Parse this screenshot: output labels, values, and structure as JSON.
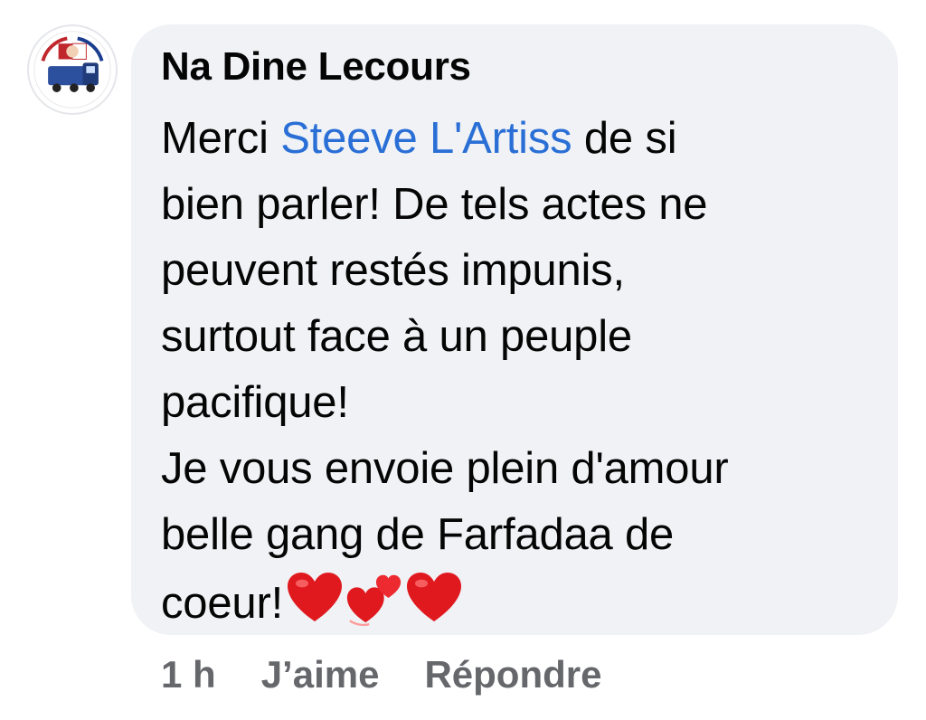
{
  "comment": {
    "author": "Na Dine Lecours",
    "message_lines": [
      {
        "before": "Merci ",
        "mention": "Steeve L'Artiss",
        "after": " de si"
      },
      "bien parler! De tels actes ne",
      "peuvent restés impunis,",
      "surtout face à un peuple",
      "pacifique!",
      "Je vous envoie plein d'amour",
      "belle gang de Farfadaa de",
      "coeur!"
    ],
    "emojis": [
      "red-heart",
      "two-hearts",
      "red-heart"
    ],
    "time": "1 h",
    "like_label": "J’aime",
    "reply_label": "Répondre"
  },
  "colors": {
    "bubble": "#f0f2f5",
    "mention": "#2a6fd6",
    "meta": "#65676b",
    "heart": "#e0191f"
  }
}
